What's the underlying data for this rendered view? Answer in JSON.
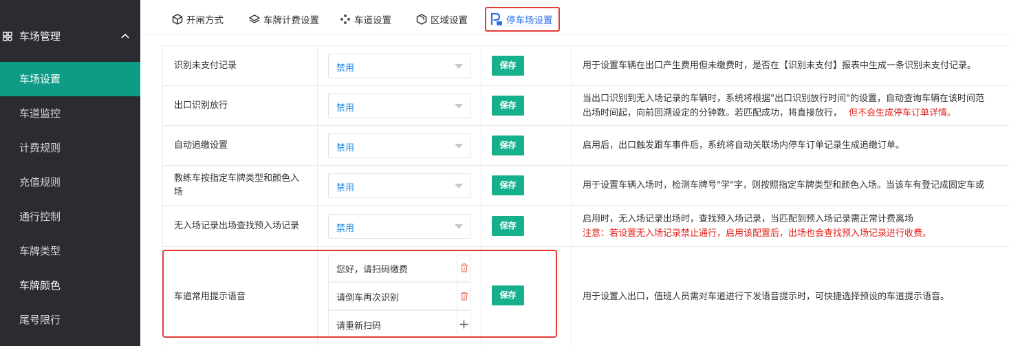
{
  "sidebar": {
    "group_label": "车场管理",
    "items": [
      {
        "label": "车场设置"
      },
      {
        "label": "车道监控"
      },
      {
        "label": "计费规则"
      },
      {
        "label": "充值规则"
      },
      {
        "label": "通行控制"
      },
      {
        "label": "车牌类型"
      },
      {
        "label": "车牌颜色"
      },
      {
        "label": "尾号限行"
      }
    ]
  },
  "tabs": [
    {
      "label": "开闸方式"
    },
    {
      "label": "车牌计费设置"
    },
    {
      "label": "车道设置"
    },
    {
      "label": "区域设置"
    },
    {
      "label": "停车场设置"
    }
  ],
  "colors": {
    "primary": "#0f9c86",
    "save": "#17b08d",
    "link": "#1a86e6",
    "alert": "#e0201a",
    "highlight": "#e33b35"
  },
  "settings": [
    {
      "name": "识别未支付记录",
      "value": "禁用",
      "save": "保存",
      "desc": [
        "用于设置车辆在出口产生费用但未缴费时，是否在【识别未支付】报表中生成一条识别未支付记录。"
      ],
      "desc_red": ""
    },
    {
      "name": "出口识别放行",
      "value": "禁用",
      "save": "保存",
      "desc": [
        "当出口识别到无入场记录的车辆时，系统将根据\"出口识别放行时间\"的设置，自动查询车辆在该时间范",
        "出场时间起，向前回溯设定的分钟数。若匹配成功，将直接放行，"
      ],
      "desc_red": "但不会生成停车订单详情。"
    },
    {
      "name": "自动追缴设置",
      "value": "禁用",
      "save": "保存",
      "desc": [
        "启用后，出口触发跟车事件后，系统将自动关联场内停车订单记录生成追缴订单。"
      ],
      "desc_red": ""
    },
    {
      "name": "教练车按指定车牌类型和颜色入场",
      "value": "禁用",
      "save": "保存",
      "desc": [
        "用于设置车辆入场时，检测车牌号\"学\"字，则按照指定车牌类型和颜色入场。当该车有登记成固定车或"
      ],
      "desc_red": ""
    },
    {
      "name": "无入场记录出场查找预入场记录",
      "value": "禁用",
      "save": "保存",
      "desc": [
        "启用时，无入场记录出场时，查找预入场记录，当匹配到预入场记录需正常计费离场"
      ],
      "desc_red": "注意：若设置无入场记录禁止通行，启用该配置后，出场也会查找预入场记录进行收费。"
    }
  ],
  "voice_setting": {
    "name": "车道常用提示语音",
    "save": "保存",
    "prompts": [
      "您好，请扫码缴费",
      "请倒车再次识别",
      "请重新扫码"
    ],
    "desc": "用于设置入出口，值班人员需对车道进行下发语音提示时，可快捷选择预设的车道提示语音。"
  }
}
